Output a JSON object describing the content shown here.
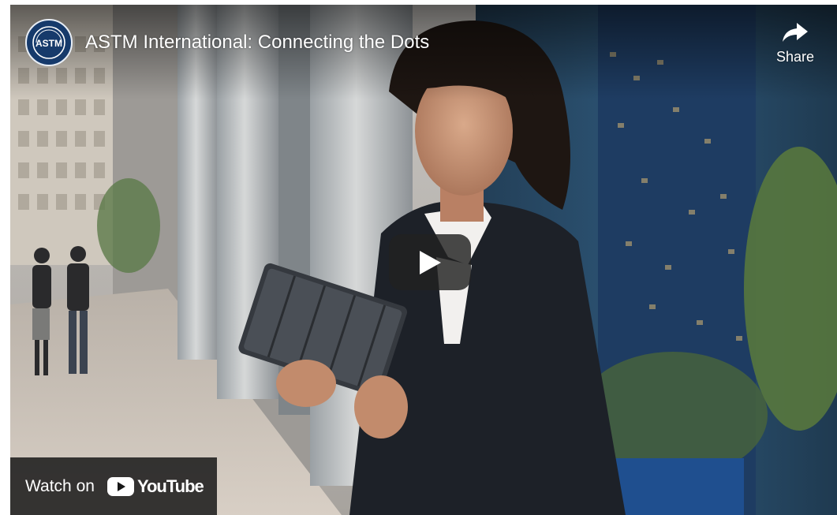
{
  "player": {
    "title": "ASTM International: Connecting the Dots",
    "channel_logo_text": "ASTM",
    "share_label": "Share",
    "watch_on_label": "Watch on",
    "platform_name": "YouTube"
  },
  "icons": {
    "share": "share-arrow-icon",
    "play": "play-icon",
    "youtube": "youtube-logo-icon"
  },
  "colors": {
    "play_bg": "#212121",
    "youtube_red": "#ffffff",
    "channel_logo_bg": "#163a6b"
  }
}
